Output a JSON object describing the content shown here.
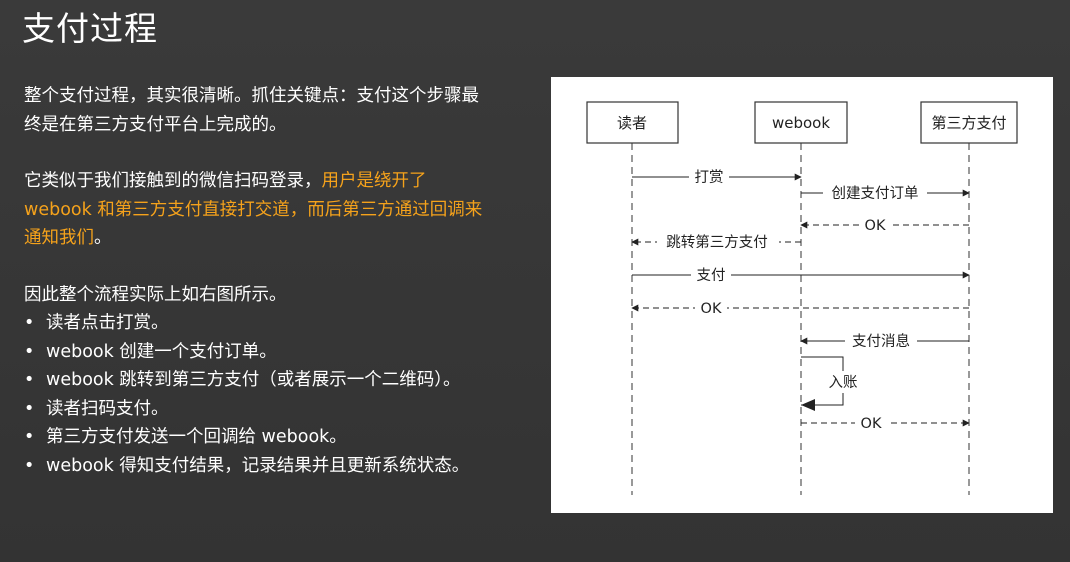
{
  "slide": {
    "title": "支付过程",
    "para1": "整个支付过程，其实很清晰。抓住关键点：支付这个步骤最终是在第三方支付平台上完成的。",
    "para2_normal_start": "它类似于我们接触到的微信扫码登录，",
    "para2_highlight": "用户是绕开了 webook 和第三方支付直接打交道，而后第三方通过回调来通知我们",
    "para2_normal_end": "。",
    "para3": "因此整个流程实际上如右图所示。",
    "bullets": [
      "读者点击打赏。",
      "webook 创建一个支付订单。",
      "webook 跳转到第三方支付（或者展示一个二维码）。",
      "读者扫码支付。",
      "第三方支付发送一个回调给 webook。",
      "webook 得知支付结果，记录结果并且更新系统状态。"
    ],
    "highlight_color": "#f5a21b"
  },
  "diagram": {
    "participants": [
      "读者",
      "webook",
      "第三方支付"
    ],
    "messages": [
      {
        "label": "打赏"
      },
      {
        "label": "创建支付订单"
      },
      {
        "label": "OK"
      },
      {
        "label": "跳转第三方支付"
      },
      {
        "label": "支付"
      },
      {
        "label": "OK"
      },
      {
        "label": "支付消息"
      },
      {
        "label": "入账"
      },
      {
        "label": "OK"
      }
    ]
  }
}
